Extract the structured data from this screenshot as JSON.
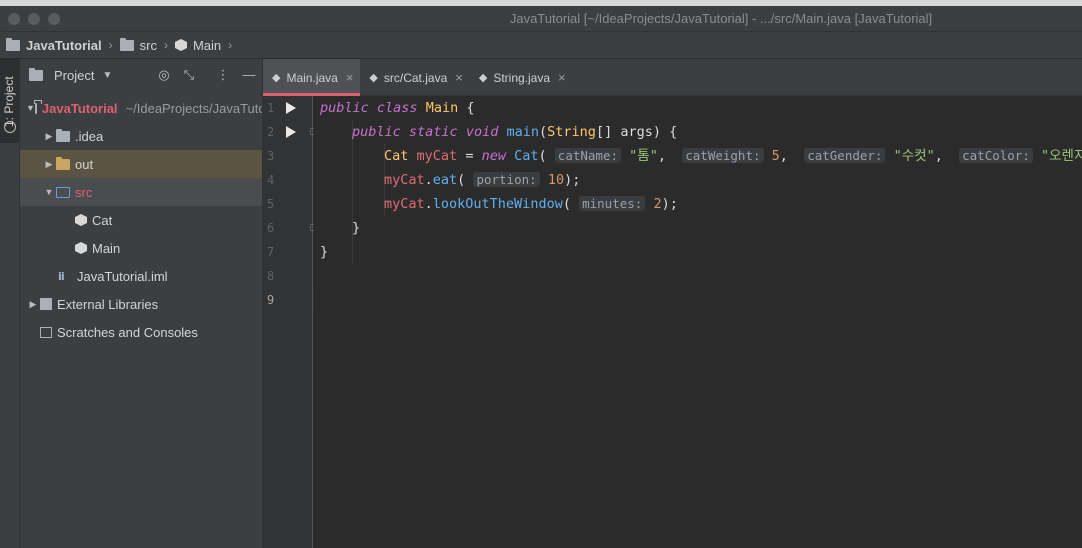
{
  "window": {
    "title": "JavaTutorial [~/IdeaProjects/JavaTutorial] - .../src/Main.java [JavaTutorial]"
  },
  "breadcrumb": {
    "project": "JavaTutorial",
    "folder": "src",
    "file": "Main"
  },
  "tool_stripe": {
    "project_tab": "1: Project"
  },
  "project_panel": {
    "title": "Project",
    "tree": {
      "root_name": "JavaTutorial",
      "root_path": "~/IdeaProjects/JavaTutorial",
      "idea": ".idea",
      "out": "out",
      "src": "src",
      "cat": "Cat",
      "main": "Main",
      "iml": "JavaTutorial.iml",
      "external_libraries": "External Libraries",
      "scratches": "Scratches and Consoles"
    }
  },
  "editor": {
    "tabs": [
      {
        "label": "Main.java",
        "active": true
      },
      {
        "label": "src/Cat.java",
        "active": false
      },
      {
        "label": "String.java",
        "active": false
      }
    ],
    "line_numbers": [
      "1",
      "2",
      "3",
      "4",
      "5",
      "6",
      "7",
      "8",
      "9"
    ],
    "current_line": "9",
    "code": {
      "l1_kw1": "public",
      "l1_kw2": "class",
      "l1_name": "Main",
      "l1_brace": "{",
      "l2_kw1": "public",
      "l2_kw2": "static",
      "l2_kw3": "void",
      "l2_fn": "main",
      "l2_paren": "(",
      "l2_type": "String",
      "l2_rest": "[] args) {",
      "l3_type": "Cat",
      "l3_var": "myCat",
      "l3_eq": "=",
      "l3_new": "new",
      "l3_ctor": "Cat",
      "l3_open": "(",
      "l3_hint1": "catName:",
      "l3_str1": "\"톰\"",
      "l3_hint2": "catWeight:",
      "l3_num": "5",
      "l3_hint3": "catGender:",
      "l3_str2": "\"수컷\"",
      "l3_hint4": "catColor:",
      "l3_str3": "\"오렌지\"",
      "l3_close": ");",
      "l4_var": "myCat",
      "l4_fn": "eat",
      "l4_hint": "portion:",
      "l4_num": "10",
      "l4_close": ");",
      "l5_var": "myCat",
      "l5_fn": "lookOutTheWindow",
      "l5_hint": "minutes:",
      "l5_num": "2",
      "l5_close": ");",
      "l6_brace": "}",
      "l7_brace": "}"
    }
  },
  "colors": {
    "accent": "#e05f6f",
    "keyword": "#c871d0",
    "class": "#ffc66d",
    "function": "#61afef",
    "string": "#98c379",
    "number": "#d19a66"
  }
}
